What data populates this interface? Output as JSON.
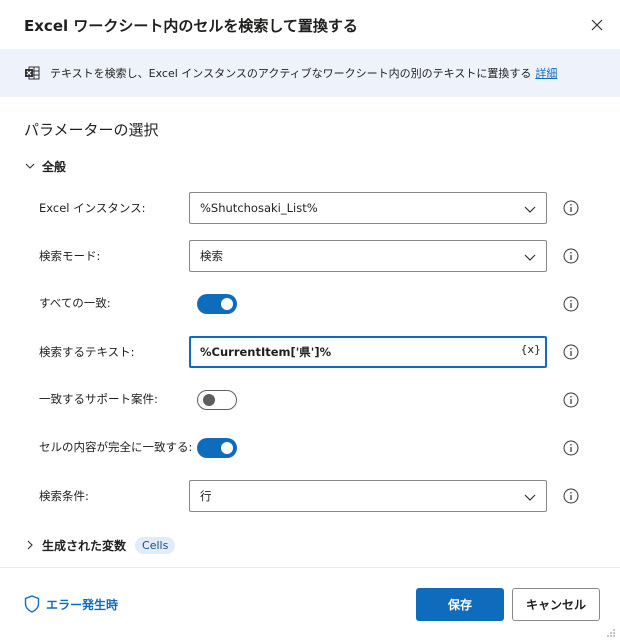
{
  "dialog": {
    "title": "Excel ワークシート内のセルを検索して置換する",
    "close_icon": "close-icon"
  },
  "banner": {
    "icon": "excel-icon",
    "text": "テキストを検索し、Excel インスタンスのアクティブなワークシート内の別のテキストに置換する",
    "link": "詳細"
  },
  "section_title": "パラメーターの選択",
  "general_group": {
    "label": "全般",
    "expanded": true
  },
  "params": {
    "excel_instance": {
      "label": "Excel インスタンス:",
      "value": "%Shutchosaki_List%"
    },
    "search_mode": {
      "label": "検索モード:",
      "value": "検索"
    },
    "all_matches": {
      "label": "すべての一致:",
      "enabled": true
    },
    "search_text": {
      "label": "検索するテキスト:",
      "value": "%CurrentItem['県']%",
      "var_button": "{x}"
    },
    "match_case": {
      "label": "一致するサポート案件:",
      "enabled": false
    },
    "match_entire": {
      "label": "セルの内容が完全に一致する:",
      "enabled": true
    },
    "search_by": {
      "label": "検索条件:",
      "value": "行"
    }
  },
  "variables": {
    "label": "生成された変数",
    "badge": "Cells"
  },
  "footer": {
    "error_label": "エラー発生時",
    "save_label": "保存",
    "cancel_label": "キャンセル"
  },
  "colors": {
    "accent": "#0f6cbd",
    "banner_bg": "#eef3fb",
    "badge_bg": "#e1ecf8"
  }
}
